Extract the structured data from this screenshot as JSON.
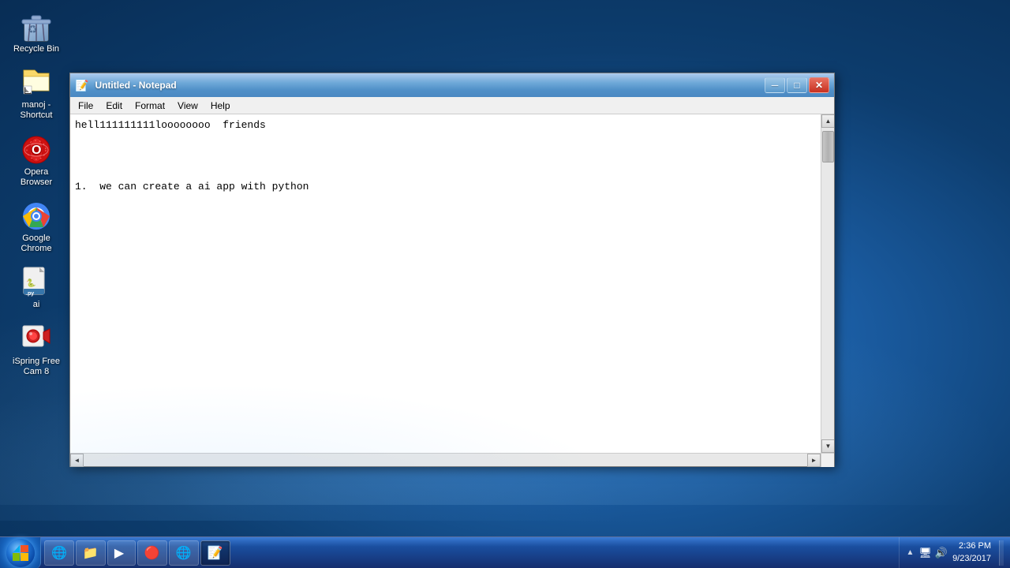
{
  "desktop": {
    "icons": [
      {
        "id": "recycle-bin",
        "label": "Recycle Bin",
        "emoji": "🗑️"
      },
      {
        "id": "computer-shortcut",
        "label": "manoj - Shortcut",
        "emoji": "📁"
      },
      {
        "id": "opera-browser",
        "label": "Opera Browser",
        "emoji": "🔴"
      },
      {
        "id": "google-chrome",
        "label": "Google Chrome",
        "emoji": "🌐"
      },
      {
        "id": "ai-file",
        "label": "ai",
        "emoji": "🐍"
      },
      {
        "id": "ispring-cam",
        "label": "iSpring Free Cam 8",
        "emoji": "🎥"
      }
    ]
  },
  "notepad": {
    "title": "Untitled - Notepad",
    "menu": [
      "File",
      "Edit",
      "Format",
      "View",
      "Help"
    ],
    "content": "hell111111111loooooooo  friends\n\n\n\n1.  we can create a ai app with python"
  },
  "taskbar": {
    "items": [
      {
        "id": "ie",
        "emoji": "🌐",
        "label": ""
      },
      {
        "id": "explorer",
        "emoji": "📁",
        "label": ""
      },
      {
        "id": "media",
        "emoji": "▶️",
        "label": ""
      },
      {
        "id": "opera",
        "emoji": "🔴",
        "label": ""
      },
      {
        "id": "chrome",
        "emoji": "🌐",
        "label": ""
      },
      {
        "id": "notepad-active",
        "emoji": "📝",
        "label": ""
      }
    ],
    "clock": {
      "time": "2:36 PM",
      "date": "9/23/2017"
    }
  }
}
